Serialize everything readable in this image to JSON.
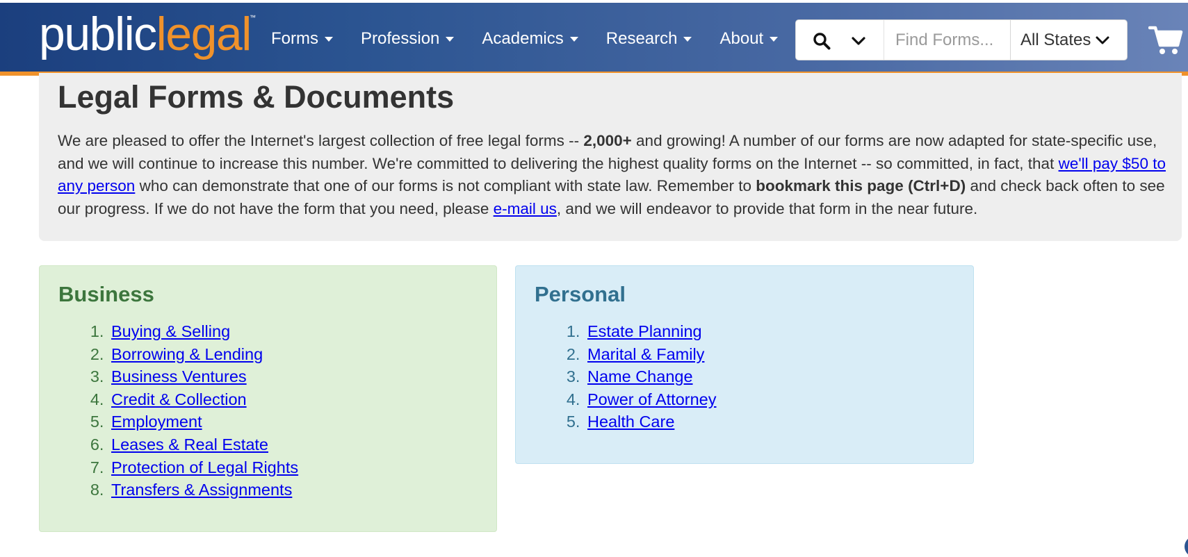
{
  "header": {
    "logo": {
      "part1": "public",
      "part2": "legal",
      "tm": "™"
    },
    "nav": [
      "Forms",
      "Profession",
      "Academics",
      "Research",
      "About"
    ],
    "search": {
      "placeholder": "Find Forms...",
      "state": "All States"
    },
    "colors": {
      "header_start": "#1b3f7e",
      "header_end": "#6a84b8",
      "accent": "#f0922b"
    }
  },
  "intro": {
    "title": "Legal Forms & Documents",
    "text_1": "We are pleased to offer the Internet's largest collection of free legal forms -- ",
    "count": "2,000+",
    "text_2": " and growing! A number of our forms are now adapted for state-specific use, and we will continue to increase this number. We're committed to delivering the highest quality forms on the Internet -- so committed, in fact, that ",
    "link_pay": "we'll pay $50 to any person",
    "text_3": " who can demonstrate that one of our forms is not compliant with state law. Remember to ",
    "bookmark": "bookmark this page (Ctrl+D)",
    "text_4": " and check back often to see our progress. If we do not have the form that you need, please ",
    "link_email": "e-mail us",
    "text_5": ", and we will endeavor to provide that form in the near future."
  },
  "business": {
    "title": "Business",
    "items": [
      "Buying & Selling",
      "Borrowing & Lending",
      "Business Ventures",
      "Credit & Collection",
      "Employment",
      "Leases & Real Estate",
      "Protection of Legal Rights",
      "Transfers & Assignments"
    ],
    "color": "#3c763d"
  },
  "personal": {
    "title": "Personal",
    "items": [
      "Estate Planning",
      "Marital & Family",
      "Name Change",
      "Power of Attorney",
      "Health Care"
    ],
    "color": "#31708f"
  }
}
